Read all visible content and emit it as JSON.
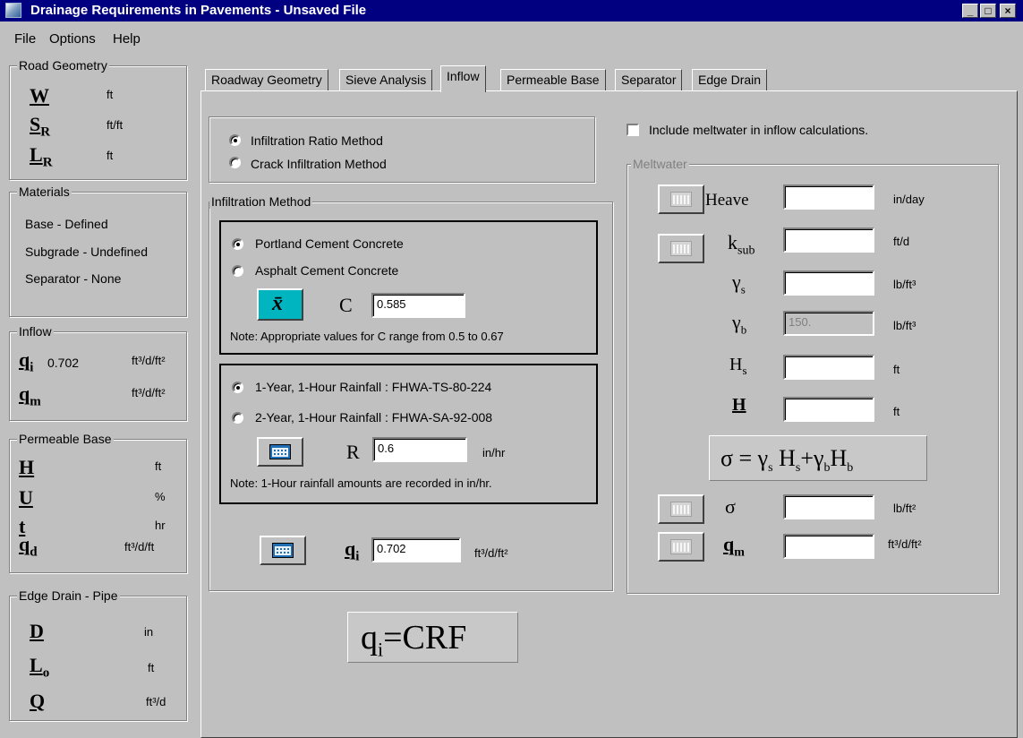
{
  "window": {
    "title": "Drainage Requirements in Pavements - Unsaved File",
    "min": "_",
    "max": "□",
    "close": "×"
  },
  "menu": [
    "File",
    "Options",
    "Help"
  ],
  "sidebar": {
    "road_geometry": {
      "title": "Road Geometry",
      "rows": [
        {
          "sym": "W",
          "unit": "ft"
        },
        {
          "sym": "S",
          "sub": "R",
          "unit": "ft/ft"
        },
        {
          "sym": "L",
          "sub": "R",
          "unit": "ft"
        }
      ]
    },
    "materials": {
      "title": "Materials",
      "items": [
        "Base - Defined",
        "Subgrade - Undefined",
        "Separator - None"
      ]
    },
    "inflow": {
      "title": "Inflow",
      "qi": {
        "sym": "q",
        "sub": "i",
        "value": "0.702",
        "unit": "ft³/d/ft²"
      },
      "qm": {
        "sym": "q",
        "sub": "m",
        "unit": "ft³/d/ft²"
      }
    },
    "permeable_base": {
      "title": "Permeable Base",
      "rows": [
        {
          "sym": "H",
          "unit": "ft"
        },
        {
          "sym": "U",
          "unit": "%"
        },
        {
          "sym": "t",
          "unit": "hr"
        },
        {
          "sym": "q",
          "sub": "d",
          "unit": "ft³/d/ft"
        }
      ]
    },
    "edge_drain": {
      "title": "Edge Drain - Pipe",
      "rows": [
        {
          "sym": "D",
          "unit": "in"
        },
        {
          "sym": "L",
          "sub": "o",
          "unit": "ft"
        },
        {
          "sym": "Q",
          "unit": "ft³/d"
        }
      ]
    }
  },
  "tabs": [
    "Roadway Geometry",
    "Sieve Analysis",
    "Inflow",
    "Permeable Base",
    "Separator",
    "Edge Drain"
  ],
  "active_tab": "Inflow",
  "method": {
    "options": [
      "Infiltration Ratio Method",
      "Crack Infiltration Method"
    ],
    "selected": 0
  },
  "infiltration": {
    "title": "Infiltration Method",
    "pavement": {
      "options": [
        "Portland Cement Concrete",
        "Asphalt Cement Concrete"
      ],
      "selected": 0
    },
    "c_label": "C",
    "c_value": "0.585",
    "c_note": "Note: Appropriate values for C range from 0.5 to 0.67",
    "rainfall": {
      "options": [
        "1-Year, 1-Hour Rainfall : FHWA-TS-80-224",
        "2-Year, 1-Hour Rainfall : FHWA-SA-92-008"
      ],
      "selected": 0
    },
    "r_label": "R",
    "r_value": "0.6",
    "r_unit": "in/hr",
    "r_note": "Note: 1-Hour rainfall amounts are recorded in in/hr.",
    "qi_value": "0.702",
    "qi_unit": "ft³/d/ft²",
    "formula": "qi = CRF"
  },
  "meltwater": {
    "checkbox_label": "Include meltwater in inflow calculations.",
    "title": "Meltwater",
    "rows": [
      {
        "label": "Heave",
        "value": "",
        "unit": "in/day"
      },
      {
        "label": "ksub",
        "value": "",
        "unit": "ft/d"
      },
      {
        "label": "γs",
        "value": "",
        "unit": "lb/ft³"
      },
      {
        "label": "γb",
        "value": "150.",
        "unit": "lb/ft³"
      },
      {
        "label": "Hs",
        "value": "",
        "unit": "ft"
      },
      {
        "label": "H",
        "value": "",
        "unit": "ft"
      },
      {
        "label": "σ",
        "value": "",
        "unit": "lb/ft²"
      },
      {
        "label": "qm",
        "value": "",
        "unit": "ft³/d/ft²"
      }
    ],
    "formula": "σ = γs Hs + γb Hb"
  }
}
